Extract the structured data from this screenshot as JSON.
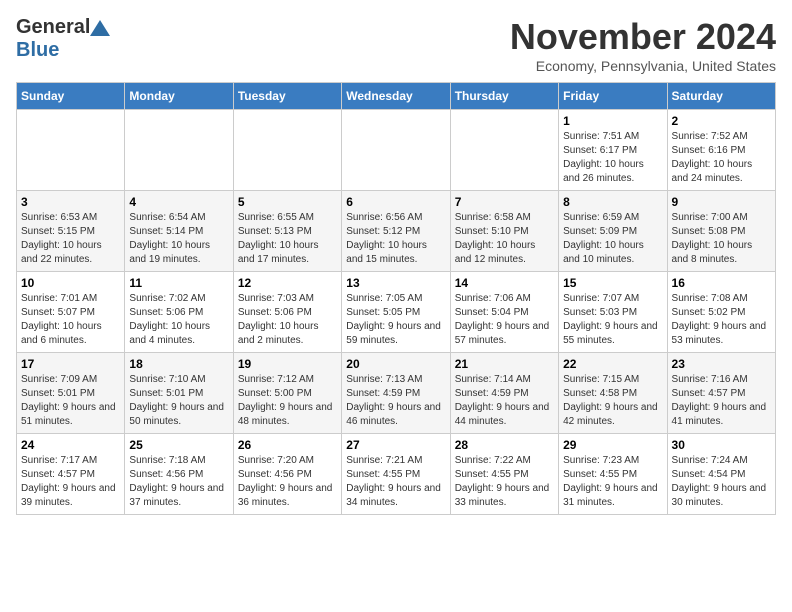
{
  "logo": {
    "general": "General",
    "blue": "Blue"
  },
  "header": {
    "month": "November 2024",
    "location": "Economy, Pennsylvania, United States"
  },
  "days_of_week": [
    "Sunday",
    "Monday",
    "Tuesday",
    "Wednesday",
    "Thursday",
    "Friday",
    "Saturday"
  ],
  "weeks": [
    [
      {
        "day": "",
        "info": ""
      },
      {
        "day": "",
        "info": ""
      },
      {
        "day": "",
        "info": ""
      },
      {
        "day": "",
        "info": ""
      },
      {
        "day": "",
        "info": ""
      },
      {
        "day": "1",
        "info": "Sunrise: 7:51 AM\nSunset: 6:17 PM\nDaylight: 10 hours and 26 minutes."
      },
      {
        "day": "2",
        "info": "Sunrise: 7:52 AM\nSunset: 6:16 PM\nDaylight: 10 hours and 24 minutes."
      }
    ],
    [
      {
        "day": "3",
        "info": "Sunrise: 6:53 AM\nSunset: 5:15 PM\nDaylight: 10 hours and 22 minutes."
      },
      {
        "day": "4",
        "info": "Sunrise: 6:54 AM\nSunset: 5:14 PM\nDaylight: 10 hours and 19 minutes."
      },
      {
        "day": "5",
        "info": "Sunrise: 6:55 AM\nSunset: 5:13 PM\nDaylight: 10 hours and 17 minutes."
      },
      {
        "day": "6",
        "info": "Sunrise: 6:56 AM\nSunset: 5:12 PM\nDaylight: 10 hours and 15 minutes."
      },
      {
        "day": "7",
        "info": "Sunrise: 6:58 AM\nSunset: 5:10 PM\nDaylight: 10 hours and 12 minutes."
      },
      {
        "day": "8",
        "info": "Sunrise: 6:59 AM\nSunset: 5:09 PM\nDaylight: 10 hours and 10 minutes."
      },
      {
        "day": "9",
        "info": "Sunrise: 7:00 AM\nSunset: 5:08 PM\nDaylight: 10 hours and 8 minutes."
      }
    ],
    [
      {
        "day": "10",
        "info": "Sunrise: 7:01 AM\nSunset: 5:07 PM\nDaylight: 10 hours and 6 minutes."
      },
      {
        "day": "11",
        "info": "Sunrise: 7:02 AM\nSunset: 5:06 PM\nDaylight: 10 hours and 4 minutes."
      },
      {
        "day": "12",
        "info": "Sunrise: 7:03 AM\nSunset: 5:06 PM\nDaylight: 10 hours and 2 minutes."
      },
      {
        "day": "13",
        "info": "Sunrise: 7:05 AM\nSunset: 5:05 PM\nDaylight: 9 hours and 59 minutes."
      },
      {
        "day": "14",
        "info": "Sunrise: 7:06 AM\nSunset: 5:04 PM\nDaylight: 9 hours and 57 minutes."
      },
      {
        "day": "15",
        "info": "Sunrise: 7:07 AM\nSunset: 5:03 PM\nDaylight: 9 hours and 55 minutes."
      },
      {
        "day": "16",
        "info": "Sunrise: 7:08 AM\nSunset: 5:02 PM\nDaylight: 9 hours and 53 minutes."
      }
    ],
    [
      {
        "day": "17",
        "info": "Sunrise: 7:09 AM\nSunset: 5:01 PM\nDaylight: 9 hours and 51 minutes."
      },
      {
        "day": "18",
        "info": "Sunrise: 7:10 AM\nSunset: 5:01 PM\nDaylight: 9 hours and 50 minutes."
      },
      {
        "day": "19",
        "info": "Sunrise: 7:12 AM\nSunset: 5:00 PM\nDaylight: 9 hours and 48 minutes."
      },
      {
        "day": "20",
        "info": "Sunrise: 7:13 AM\nSunset: 4:59 PM\nDaylight: 9 hours and 46 minutes."
      },
      {
        "day": "21",
        "info": "Sunrise: 7:14 AM\nSunset: 4:59 PM\nDaylight: 9 hours and 44 minutes."
      },
      {
        "day": "22",
        "info": "Sunrise: 7:15 AM\nSunset: 4:58 PM\nDaylight: 9 hours and 42 minutes."
      },
      {
        "day": "23",
        "info": "Sunrise: 7:16 AM\nSunset: 4:57 PM\nDaylight: 9 hours and 41 minutes."
      }
    ],
    [
      {
        "day": "24",
        "info": "Sunrise: 7:17 AM\nSunset: 4:57 PM\nDaylight: 9 hours and 39 minutes."
      },
      {
        "day": "25",
        "info": "Sunrise: 7:18 AM\nSunset: 4:56 PM\nDaylight: 9 hours and 37 minutes."
      },
      {
        "day": "26",
        "info": "Sunrise: 7:20 AM\nSunset: 4:56 PM\nDaylight: 9 hours and 36 minutes."
      },
      {
        "day": "27",
        "info": "Sunrise: 7:21 AM\nSunset: 4:55 PM\nDaylight: 9 hours and 34 minutes."
      },
      {
        "day": "28",
        "info": "Sunrise: 7:22 AM\nSunset: 4:55 PM\nDaylight: 9 hours and 33 minutes."
      },
      {
        "day": "29",
        "info": "Sunrise: 7:23 AM\nSunset: 4:55 PM\nDaylight: 9 hours and 31 minutes."
      },
      {
        "day": "30",
        "info": "Sunrise: 7:24 AM\nSunset: 4:54 PM\nDaylight: 9 hours and 30 minutes."
      }
    ]
  ]
}
